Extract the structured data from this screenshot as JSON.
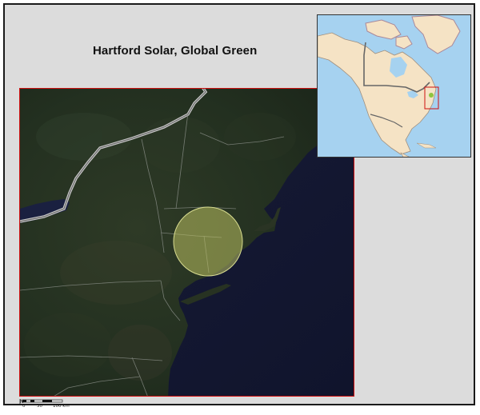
{
  "map": {
    "title": "Hartford Solar, Global Green",
    "colors": {
      "background": "#dcdcdc",
      "main_frame": "#d01010",
      "study_area": "#b9c060",
      "imagery_land": "#233020",
      "imagery_water": "#151a35",
      "inset_land": "#f5e3c5",
      "inset_water": "#a6d2f0"
    },
    "scale_bar": {
      "north_label": "N",
      "tick_labels": [
        "0",
        "50",
        "100 km"
      ]
    }
  }
}
